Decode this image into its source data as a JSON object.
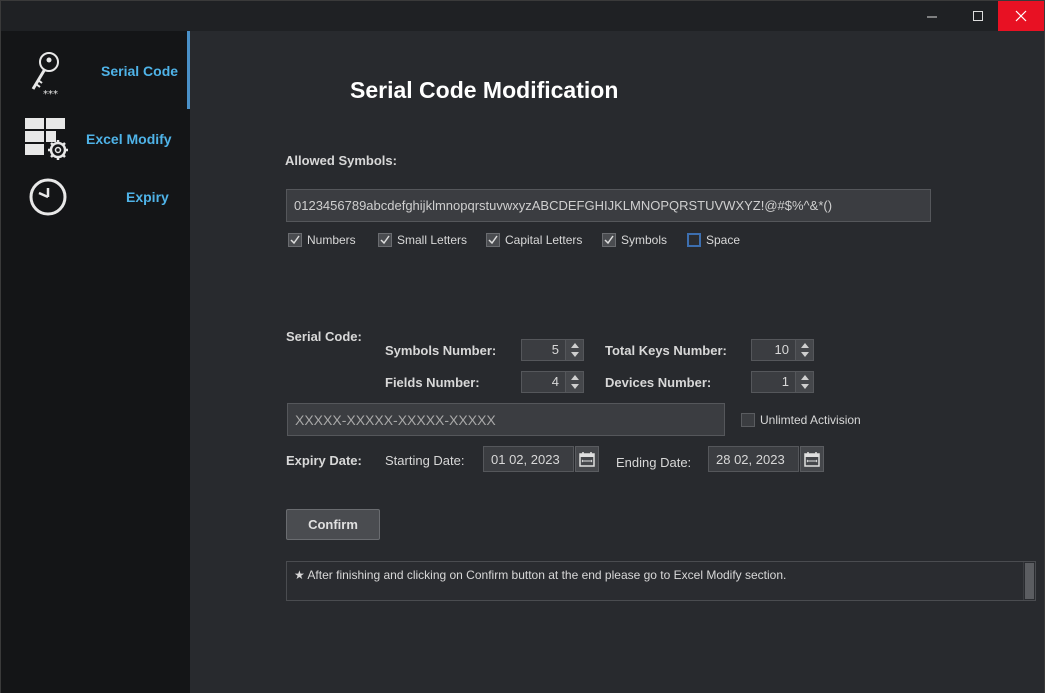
{
  "window": {
    "minimize_icon": "minimize-icon",
    "maximize_icon": "maximize-icon",
    "close_icon": "close-icon"
  },
  "sidebar": {
    "items": [
      {
        "label": "Serial Code",
        "icon": "key-icon",
        "active": true
      },
      {
        "label": "Excel Modify",
        "icon": "grid-gear-icon",
        "active": false
      },
      {
        "label": "Expiry",
        "icon": "clock-icon",
        "active": false
      }
    ],
    "accent": "#4fb3e8"
  },
  "main": {
    "title": "Serial Code Modification",
    "allowed_symbols": {
      "label": "Allowed Symbols:",
      "value": "0123456789abcdefghijklmnopqrstuvwxyzABCDEFGHIJKLMNOPQRSTUVWXYZ!@#$%^&*()",
      "checkboxes": [
        {
          "label": "Numbers",
          "checked": true
        },
        {
          "label": "Small Letters",
          "checked": true
        },
        {
          "label": "Capital Letters",
          "checked": true
        },
        {
          "label": "Symbols",
          "checked": true
        },
        {
          "label": "Space",
          "checked": false
        }
      ]
    },
    "serial_code": {
      "label": "Serial Code:",
      "symbols_number_label": "Symbols Number:",
      "symbols_number": "5",
      "total_keys_label": "Total Keys Number:",
      "total_keys": "10",
      "fields_number_label": "Fields Number:",
      "fields_number": "4",
      "devices_number_label": "Devices Number:",
      "devices_number": "1",
      "preview": "XXXXX-XXXXX-XXXXX-XXXXX",
      "unlimited_label": "Unlimted Activision",
      "unlimited_checked": false
    },
    "expiry": {
      "label": "Expiry Date:",
      "starting_label": "Starting Date:",
      "starting_value": "01 02, 2023",
      "ending_label": "Ending Date:",
      "ending_value": "28 02, 2023"
    },
    "confirm_label": "Confirm",
    "note": "★ After finishing and clicking on Confirm button at the end please go to Excel Modify section."
  }
}
